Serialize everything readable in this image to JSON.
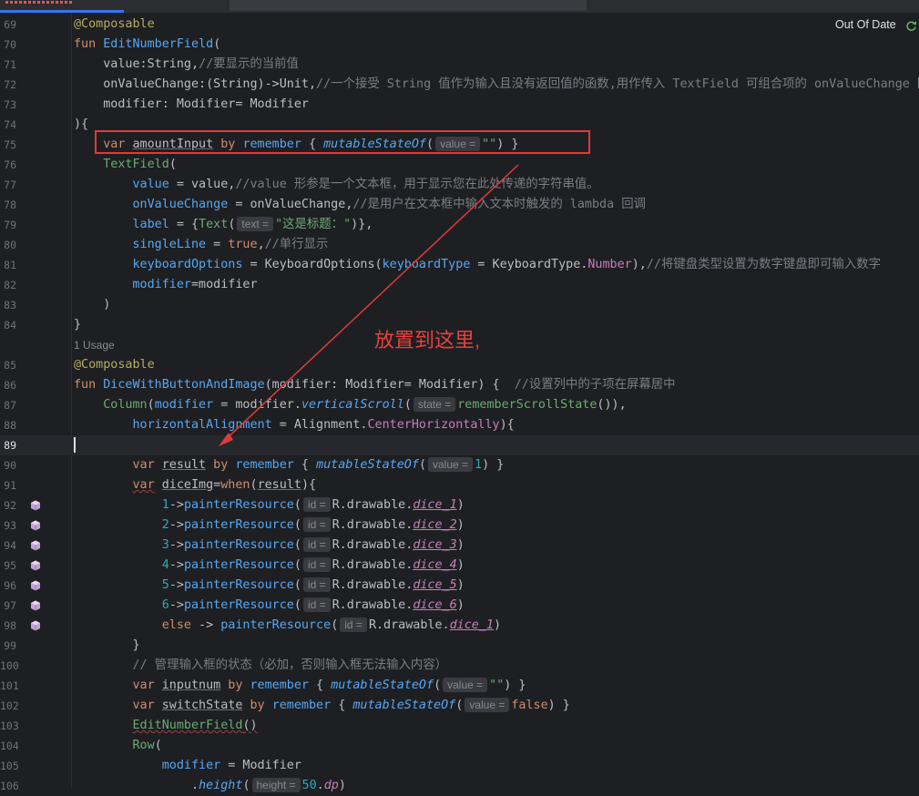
{
  "editor": {
    "status_label": "Out Of Date",
    "annotation_text": "放置到这里,",
    "usage_label": "1 Usage"
  },
  "lines": {
    "l69": "69",
    "l70": "70",
    "l71": "71",
    "l72": "72",
    "l73": "73",
    "l74": "74",
    "l75": "75",
    "l76": "76",
    "l77": "77",
    "l78": "78",
    "l79": "79",
    "l80": "80",
    "l81": "81",
    "l82": "82",
    "l83": "83",
    "l84": "84",
    "l85": "85",
    "l86": "86",
    "l87": "87",
    "l88": "88",
    "l89": "89",
    "l90": "90",
    "l91": "91",
    "l92": "92",
    "l93": "93",
    "l94": "94",
    "l95": "95",
    "l96": "96",
    "l97": "97",
    "l98": "98",
    "l99": "99",
    "l100": "100",
    "l101": "101",
    "l102": "102",
    "l103": "103",
    "l104": "104",
    "l105": "105",
    "l106": "106"
  },
  "code": {
    "c69": "@Composable",
    "c70a": "fun ",
    "c70b": "EditNumberField",
    "c70c": "(",
    "c71a": "    value:String,",
    "c71b": "//要显示的当前值",
    "c72a": "    onValueChange:(String)->Unit,",
    "c72b": "//一个接受 String 值作为输入且没有返回值的函数,用作传入 TextField 可组合项的 onValueChange 回调",
    "c73": "    modifier: Modifier= Modifier",
    "c74": "){",
    "c75a": "    ",
    "c75b": "var ",
    "c75c": "amountInput",
    "c75d": " by ",
    "c75e": "remember",
    "c75f": " { ",
    "c75g": "mutableStateOf",
    "c75h": "(",
    "c75hint": "value =",
    "c75i": "\"\"",
    "c75j": ") }",
    "c76a": "    ",
    "c76b": "TextField",
    "c76c": "(",
    "c77a": "        ",
    "c77b": "value",
    "c77c": " = value,",
    "c77d": "//value 形参是一个文本框，用于显示您在此处传递的字符串值。",
    "c78a": "        ",
    "c78b": "onValueChange",
    "c78c": " = onValueChange,",
    "c78d": "//是用户在文本框中输入文本时触发的 lambda 回调",
    "c79a": "        ",
    "c79b": "label",
    "c79c": " = {",
    "c79d": "Text",
    "c79e": "(",
    "c79hint": "text =",
    "c79f": "\"这是标题：\"",
    "c79g": ")},",
    "c80a": "        ",
    "c80b": "singleLine",
    "c80c": " = ",
    "c80d": "true",
    "c80e": ",",
    "c80f": "//单行显示",
    "c81a": "        ",
    "c81b": "keyboardOptions",
    "c81c": " = KeyboardOptions(",
    "c81d": "keyboardType",
    "c81e": " = KeyboardType.",
    "c81f": "Number",
    "c81g": "),",
    "c81h": "//将键盘类型设置为数字键盘即可输入数字",
    "c82a": "        ",
    "c82b": "modifier",
    "c82c": "=modifier",
    "c83": "    )",
    "c84": "}",
    "c85": "@Composable",
    "c86a": "fun ",
    "c86b": "DiceWithButtonAndImage",
    "c86c": "(modifier: Modifier= Modifier) {  ",
    "c86d": "//设置列中的子项在屏幕居中",
    "c87a": "    ",
    "c87b": "Column",
    "c87c": "(",
    "c87d": "modifier",
    "c87e": " = modifier.",
    "c87f": "verticalScroll",
    "c87g": "(",
    "c87hint": "state =",
    "c87h": "rememberScrollState",
    "c87i": "()),",
    "c88a": "        ",
    "c88b": "horizontalAlignment",
    "c88c": " = Alignment.",
    "c88d": "CenterHorizontally",
    "c88e": "){",
    "c90a": "        ",
    "c90b": "var ",
    "c90c": "result",
    "c90d": " by ",
    "c90e": "remember",
    "c90f": " { ",
    "c90g": "mutableStateOf",
    "c90h": "(",
    "c90hint": "value =",
    "c90i": "1",
    "c90j": ") }",
    "c91a": "        ",
    "c91b": "var",
    "c91c": " ",
    "c91d": "diceImg",
    "c91e": "=",
    "c91f": "when",
    "c91g": "(",
    "c91h": "result",
    "c91i": "){",
    "dice": [
      {
        "num": "1",
        "res": "dice_1"
      },
      {
        "num": "2",
        "res": "dice_2"
      },
      {
        "num": "3",
        "res": "dice_3"
      },
      {
        "num": "4",
        "res": "dice_4"
      },
      {
        "num": "5",
        "res": "dice_5"
      },
      {
        "num": "6",
        "res": "dice_6"
      }
    ],
    "dice_arrow": "->",
    "dice_fn": "painterResource",
    "dice_paren": "(",
    "dice_hint": "id =",
    "dice_r": "R.drawable.",
    "dice_close": ")",
    "c98a": "            ",
    "c98b": "else",
    "c98c": " -> ",
    "c98d": "painterResource",
    "c98e": "(",
    "c98hint": "id =",
    "c98f": "R.drawable.",
    "c98g": "dice_1",
    "c98h": ")",
    "c99": "        }",
    "c100a": "        ",
    "c100b": "// 管理输入框的状态（必加，否则输入框无法输入内容）",
    "c101a": "        ",
    "c101b": "var ",
    "c101c": "inputnum",
    "c101d": " by ",
    "c101e": "remember",
    "c101f": " { ",
    "c101g": "mutableStateOf",
    "c101h": "(",
    "c101hint": "value =",
    "c101i": "\"\"",
    "c101j": ") }",
    "c102a": "        ",
    "c102b": "var ",
    "c102c": "switchState",
    "c102d": " by ",
    "c102e": "remember",
    "c102f": " { ",
    "c102g": "mutableStateOf",
    "c102h": "(",
    "c102hint": "value =",
    "c102i": "false",
    "c102j": ") }",
    "c103a": "        ",
    "c103b": "EditNumberField",
    "c103c": "()",
    "c104a": "        ",
    "c104b": "Row",
    "c104c": "(",
    "c105a": "            ",
    "c105b": "modifier",
    "c105c": " = Modifier",
    "c106a": "                .",
    "c106b": "height",
    "c106c": "(",
    "c106hint": "height =",
    "c106d": "50",
    "c106e": ".",
    "c106f": "dp",
    "c106g": ")"
  },
  "colors": {
    "highlight_box": "#e03b3b",
    "annotation": "#e8403d",
    "background": "#1e1f22"
  },
  "icons": [
    "refresh-icon",
    "image-resource-icon"
  ]
}
